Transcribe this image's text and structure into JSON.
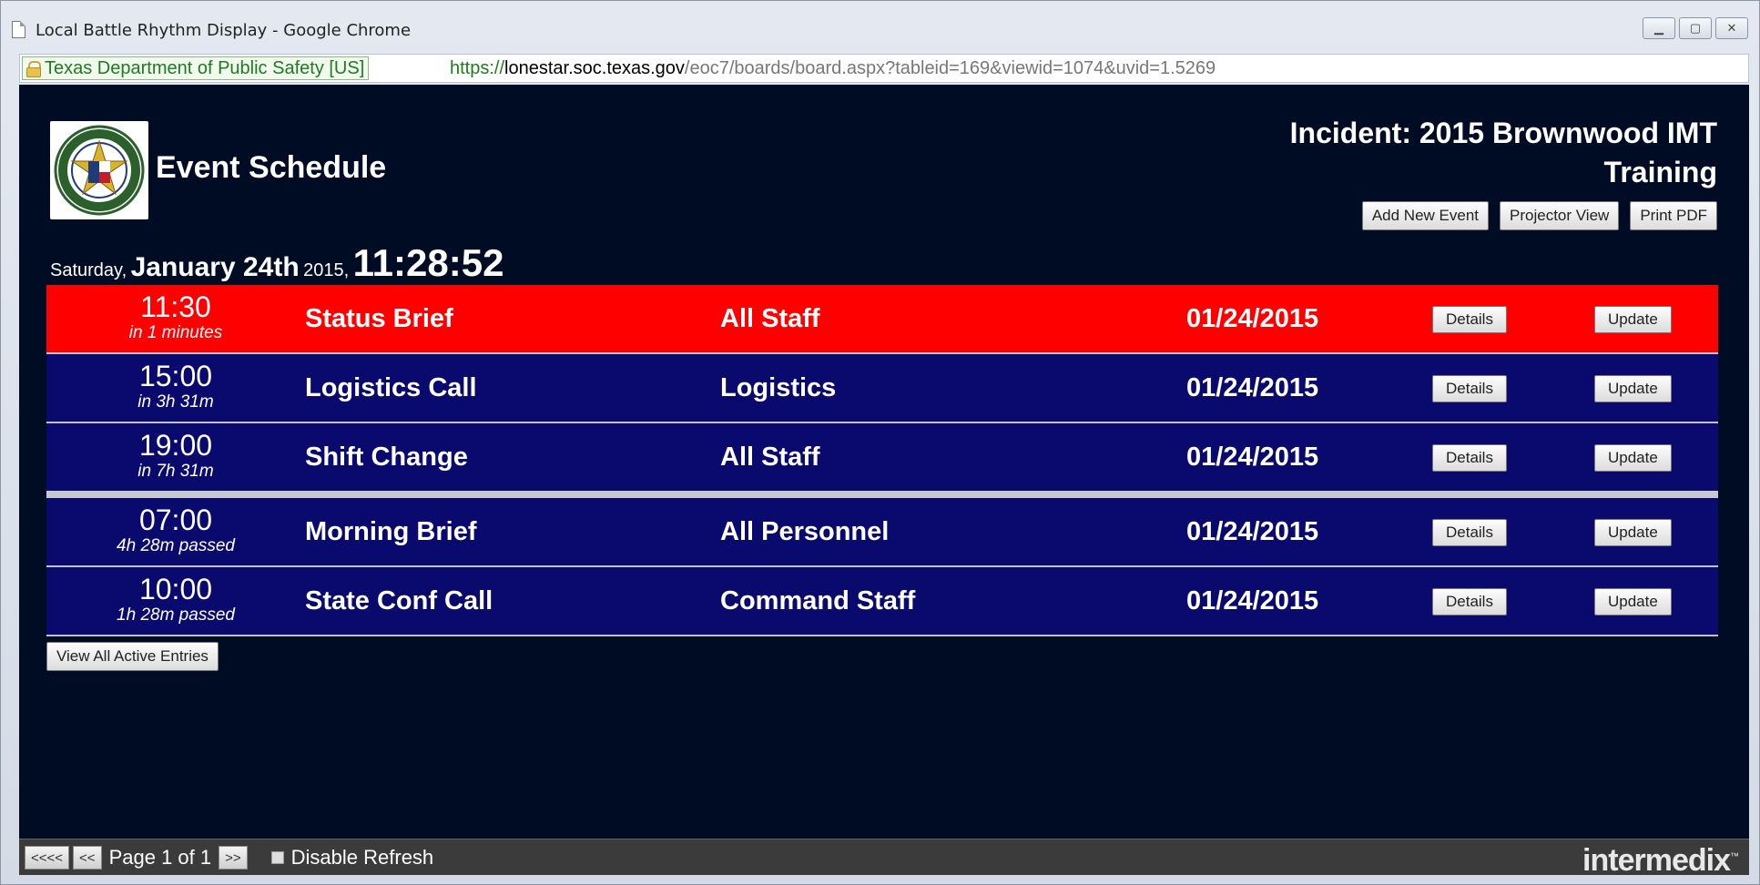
{
  "window": {
    "title": "Local Battle Rhythm Display - Google Chrome",
    "secure_label": "Texas Department of Public Safety [US]",
    "url_scheme": "https://",
    "url_host": "lonestar.soc.texas.gov",
    "url_path": "/eoc7/boards/board.aspx?tableid=169&viewid=1074&uvid=1.5269"
  },
  "header": {
    "logo_icon": "texas-dps-emergency-management-seal",
    "heading": "Event Schedule",
    "incident_line1": "Incident: 2015 Brownwood IMT",
    "incident_line2": "Training",
    "add_new_event": "Add New Event",
    "projector_view": "Projector View",
    "print_pdf": "Print PDF"
  },
  "clock": {
    "weekday": "Saturday,",
    "date": "January 24th",
    "year": "2015,",
    "time": "11:28:52"
  },
  "events": [
    {
      "time": "11:30",
      "relative": "in 1 minutes",
      "name": "Status Brief",
      "group": "All Staff",
      "date": "01/24/2015",
      "details": "Details",
      "update": "Update",
      "highlight": true
    },
    {
      "time": "15:00",
      "relative": "in 3h 31m",
      "name": "Logistics Call",
      "group": "Logistics",
      "date": "01/24/2015",
      "details": "Details",
      "update": "Update",
      "highlight": false
    },
    {
      "time": "19:00",
      "relative": "in 7h 31m",
      "name": "Shift Change",
      "group": "All Staff",
      "date": "01/24/2015",
      "details": "Details",
      "update": "Update",
      "highlight": false
    },
    {
      "time": "07:00",
      "relative": "4h 28m passed",
      "name": "Morning Brief",
      "group": "All Personnel",
      "date": "01/24/2015",
      "details": "Details",
      "update": "Update",
      "highlight": false
    },
    {
      "time": "10:00",
      "relative": "1h 28m passed",
      "name": "State Conf Call",
      "group": "Command Staff",
      "date": "01/24/2015",
      "details": "Details",
      "update": "Update",
      "highlight": false
    }
  ],
  "view_all": "View All Active Entries",
  "footer": {
    "first": "<<<<",
    "prev": "<<",
    "page_label": "Page 1 of 1",
    "next": ">>",
    "disable_refresh": "Disable Refresh",
    "brand": "intermedix",
    "brand_mark": "™"
  },
  "colors": {
    "page_bg": "#000c24",
    "row_bg": "#0a0a6e",
    "row_alert": "#ff0000",
    "secure_green": "#1e7b1e"
  }
}
